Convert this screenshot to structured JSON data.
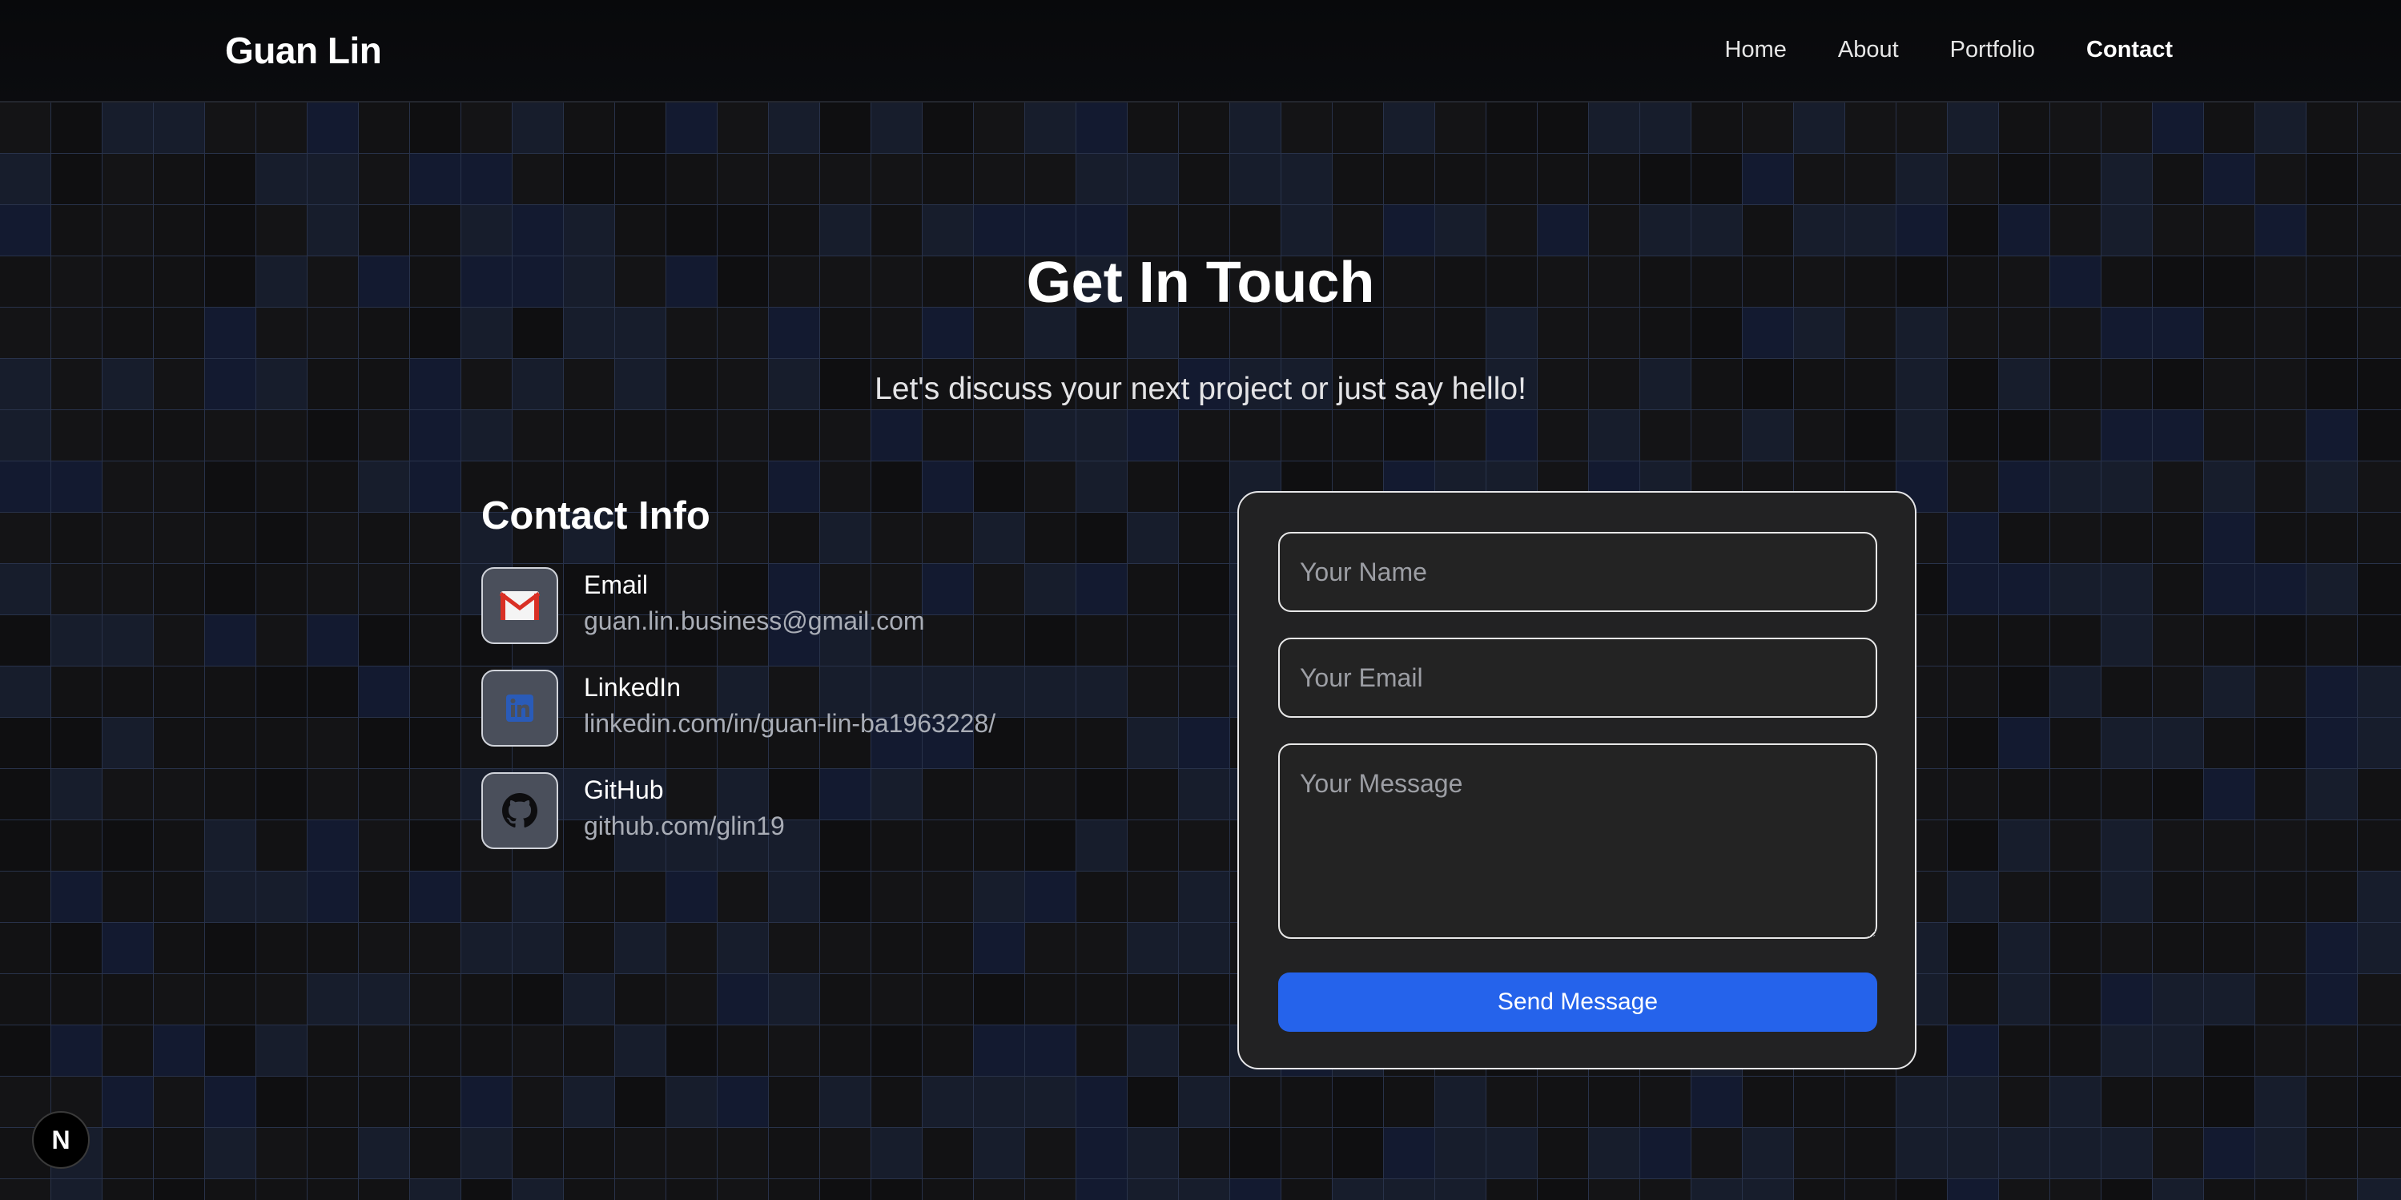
{
  "header": {
    "brand": "Guan Lin",
    "nav": [
      {
        "label": "Home"
      },
      {
        "label": "About"
      },
      {
        "label": "Portfolio"
      },
      {
        "label": "Contact"
      }
    ]
  },
  "hero": {
    "title": "Get In Touch",
    "subtitle": "Let's discuss your next project or just say hello!"
  },
  "contact_info": {
    "heading": "Contact Info",
    "items": [
      {
        "label": "Email",
        "value": "guan.lin.business@gmail.com",
        "icon": "gmail-icon"
      },
      {
        "label": "LinkedIn",
        "value": "linkedin.com/in/guan-lin-ba1963228/",
        "icon": "linkedin-icon"
      },
      {
        "label": "GitHub",
        "value": "github.com/glin19",
        "icon": "github-icon"
      }
    ]
  },
  "form": {
    "name_placeholder": "Your Name",
    "email_placeholder": "Your Email",
    "message_placeholder": "Your Message",
    "submit_label": "Send Message"
  },
  "badge": {
    "label": "N"
  },
  "colors": {
    "accent": "#2563eb",
    "background": "#0e0e10",
    "card": "#222223"
  }
}
